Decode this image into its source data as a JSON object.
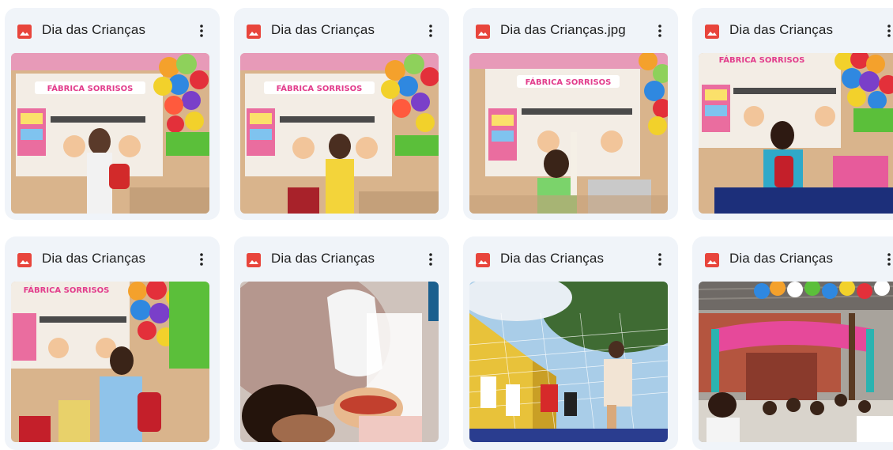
{
  "files": [
    {
      "name": "Dia das Crianças"
    },
    {
      "name": "Dia das Crianças"
    },
    {
      "name": "Dia das Crianças.jpg"
    },
    {
      "name": "Dia das Crianças"
    },
    {
      "name": "Dia das Crianças"
    },
    {
      "name": "Dia das Crianças"
    },
    {
      "name": "Dia das Crianças"
    },
    {
      "name": "Dia das Crianças"
    }
  ],
  "photo_banner_text": "FÁBRICA SORRISOS",
  "colors": {
    "card_bg": "#f0f4f9",
    "image_icon": "#e8453c",
    "text": "#1f1f1f"
  },
  "icons": {
    "file_type": "image-file-icon",
    "more": "more-vert-icon"
  }
}
